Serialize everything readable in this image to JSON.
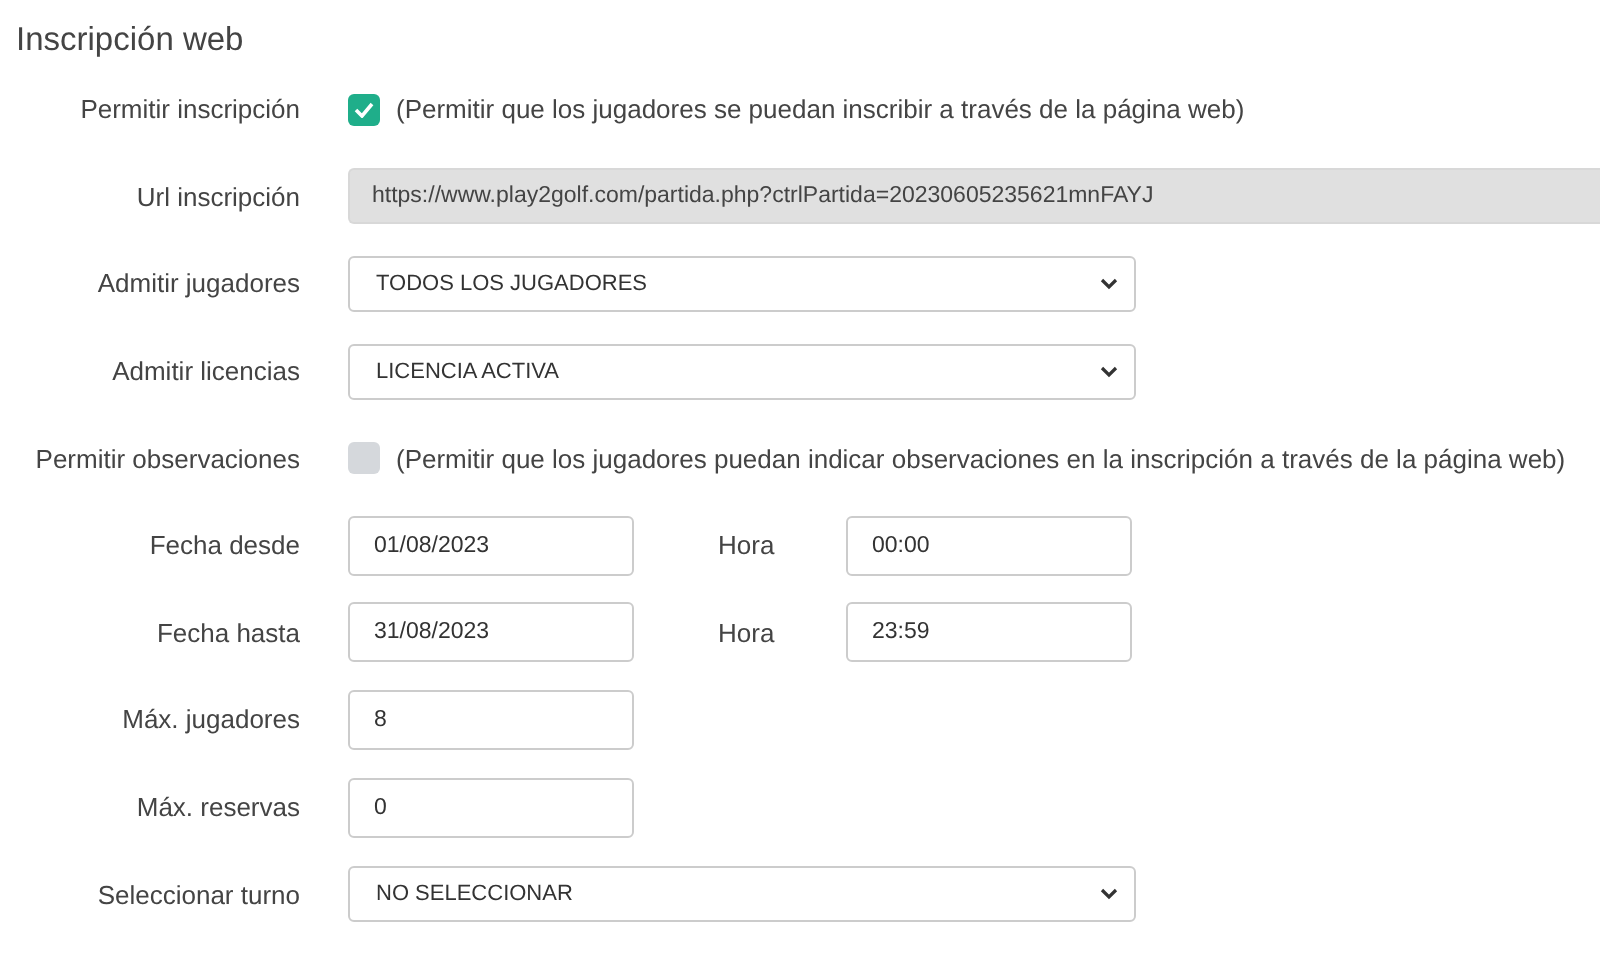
{
  "title": "Inscripción web",
  "rows": [
    {
      "kind": "checkbox",
      "label": "Permitir inscripción",
      "checked": true,
      "text": "(Permitir que los jugadores se puedan inscribir a través de la página web)"
    },
    {
      "kind": "readonly",
      "label": "Url inscripción",
      "value": "https://www.play2golf.com/partida.php?ctrlPartida=20230605235621mnFAYJ"
    },
    {
      "kind": "select",
      "label": "Admitir jugadores",
      "value": "TODOS LOS JUGADORES"
    },
    {
      "kind": "select",
      "label": "Admitir licencias",
      "value": "LICENCIA ACTIVA"
    },
    {
      "kind": "checkbox",
      "label": "Permitir observaciones",
      "checked": false,
      "text": "(Permitir que los jugadores puedan indicar observaciones en la inscripción a través de la página web)"
    },
    {
      "kind": "pair",
      "label": "Fecha desde",
      "value": "01/08/2023",
      "label2": "Hora",
      "value2": "00:00"
    },
    {
      "kind": "pair",
      "label": "Fecha hasta",
      "value": "31/08/2023",
      "label2": "Hora",
      "value2": "23:59"
    },
    {
      "kind": "text",
      "label": "Máx. jugadores",
      "value": "8"
    },
    {
      "kind": "text",
      "label": "Máx. reservas",
      "value": "0"
    },
    {
      "kind": "select",
      "label": "Seleccionar turno",
      "value": "NO SELECCIONAR"
    }
  ]
}
